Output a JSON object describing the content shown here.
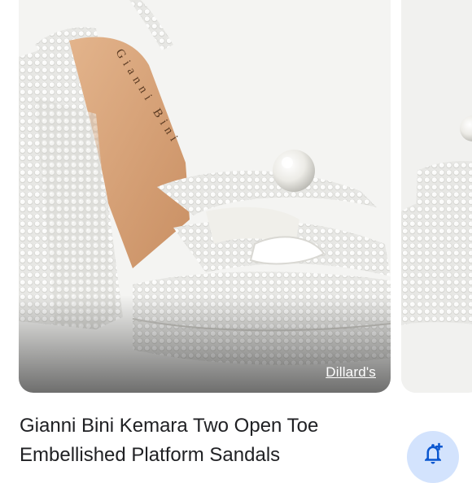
{
  "product": {
    "title": "Gianni Bini Kemara Two Open Toe Embellished Platform Sandals",
    "source": "Dillard's",
    "insole_brand_text": "Gianni Bini"
  },
  "actions": {
    "price_alert_icon": "bell-plus-icon"
  },
  "colors": {
    "accent": "#0b57d0",
    "fab_background": "#d3e3fd",
    "text": "#202124"
  }
}
